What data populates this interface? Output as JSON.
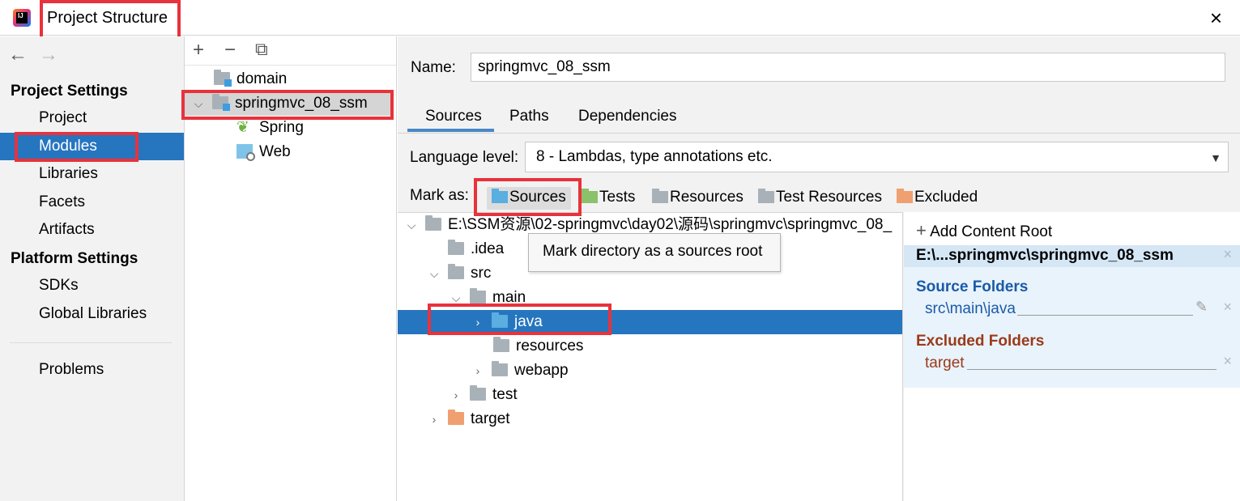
{
  "window": {
    "title": "Project Structure",
    "close_icon": "×"
  },
  "nav": {
    "back_icon": "←",
    "forward_icon": "→",
    "project_settings_header": "Project Settings",
    "platform_settings_header": "Platform Settings",
    "items": [
      {
        "label": "Project"
      },
      {
        "label": "Modules"
      },
      {
        "label": "Libraries"
      },
      {
        "label": "Facets"
      },
      {
        "label": "Artifacts"
      },
      {
        "label": "SDKs"
      },
      {
        "label": "Global Libraries"
      },
      {
        "label": "Problems"
      }
    ]
  },
  "module_toolbar": {
    "add_icon": "+",
    "remove_icon": "−",
    "copy_icon": "⧉"
  },
  "module_tree": [
    {
      "label": "domain"
    },
    {
      "label": "springmvc_08_ssm"
    },
    {
      "label": "Spring"
    },
    {
      "label": "Web"
    }
  ],
  "name_field": {
    "label": "Name:",
    "value": "springmvc_08_ssm"
  },
  "tabs": [
    {
      "label": "Sources"
    },
    {
      "label": "Paths"
    },
    {
      "label": "Dependencies"
    }
  ],
  "language_level": {
    "label": "Language level:",
    "value": "8 - Lambdas, type annotations etc.",
    "arrow": "▼"
  },
  "mark_as": {
    "label": "Mark as:",
    "buttons": [
      {
        "label": "Sources",
        "color": "#5aaee0"
      },
      {
        "label": "Tests",
        "color": "#8cc16b"
      },
      {
        "label": "Resources",
        "color": "#a9b1b8"
      },
      {
        "label": "Test Resources",
        "color": "#a9b1b8"
      },
      {
        "label": "Excluded",
        "color": "#f0a070"
      }
    ]
  },
  "folder_tree": [
    {
      "label": "E:\\SSM资源\\02-springmvc\\day02\\源码\\springmvc\\springmvc_08_"
    },
    {
      "label": ".idea"
    },
    {
      "label": "src"
    },
    {
      "label": "main"
    },
    {
      "label": "java"
    },
    {
      "label": "resources"
    },
    {
      "label": "webapp"
    },
    {
      "label": "test"
    },
    {
      "label": "target"
    }
  ],
  "tooltip": "Mark directory as a sources root",
  "content_root": {
    "add_label": "Add Content Root",
    "add_icon": "+",
    "path": "E:\\...springmvc\\springmvc_08_ssm",
    "source_folders_title": "Source Folders",
    "source_folder": "src\\main\\java",
    "excluded_folders_title": "Excluded Folders",
    "excluded_folder": "target",
    "source_color": "#1a5aa8",
    "excluded_color": "#9a3a1a",
    "remove_icon": "×",
    "edit_icon": "✎"
  },
  "colors": {
    "selection": "#2675bf",
    "highlight_box": "#e8323c"
  }
}
